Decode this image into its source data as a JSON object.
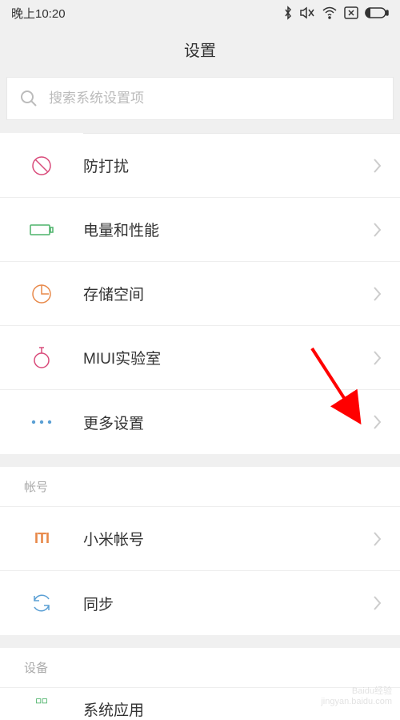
{
  "status": {
    "time": "晚上10:20"
  },
  "header": {
    "title": "设置"
  },
  "search": {
    "placeholder": "搜索系统设置项"
  },
  "section1": {
    "dnd": "防打扰",
    "battery": "电量和性能",
    "storage": "存储空间",
    "lab": "MIUI实验室",
    "more": "更多设置"
  },
  "section2": {
    "header": "帐号",
    "mi_account": "小米帐号",
    "sync": "同步"
  },
  "section3": {
    "header": "设备",
    "system_apps": "系统应用"
  },
  "watermark": {
    "line1": "Baidu经验",
    "line2": "jingyan.baidu.com"
  }
}
